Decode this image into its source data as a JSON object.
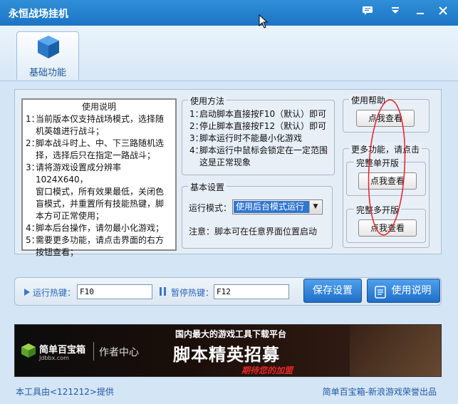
{
  "window": {
    "title": "永恒战场挂机"
  },
  "titlebar": {
    "icons": [
      "message-icon",
      "dropdown-icon",
      "minimize-icon",
      "close-icon"
    ]
  },
  "toolbar": {
    "tab_basic": "基础功能"
  },
  "instructions": {
    "title": "使用说明",
    "items": [
      {
        "num": "1：",
        "lines": [
          "当前版本仅支持战场模式，选择随",
          "机英雄进行战斗；"
        ]
      },
      {
        "num": "2：",
        "lines": [
          "脚本战斗时上、中、下三路随机选",
          "择，选择后只在指定一路战斗；"
        ]
      },
      {
        "num": "3：",
        "lines": [
          "请将游戏设置成分辨率1024X640，",
          "窗口模式，所有效果最低，关闭色",
          "盲模式，并重置所有技能热键，脚",
          "本方可正常使用；"
        ]
      },
      {
        "num": "4：",
        "lines": [
          "脚本后台操作，请勿最小化游戏；"
        ]
      },
      {
        "num": "5：",
        "lines": [
          "需要更多功能，请点击界面的右方",
          "按钮查看；"
        ]
      }
    ]
  },
  "usage": {
    "title": "使用方法",
    "items": [
      {
        "num": "1：",
        "lines": [
          "启动脚本直接按F10（默认）即可"
        ]
      },
      {
        "num": "2：",
        "lines": [
          "停止脚本直接按F12（默认）即可"
        ]
      },
      {
        "num": "3：",
        "lines": [
          "脚本运行时不能最小化游戏"
        ]
      },
      {
        "num": "4：",
        "lines": [
          "脚本运行中鼠标会锁定在一定范围",
          "这是正常现象"
        ]
      }
    ]
  },
  "basic_settings": {
    "title": "基本设置",
    "mode_label": "运行模式：",
    "mode_value": "使用后台模式运行",
    "note": "注意：脚本可在任意界面位置启动"
  },
  "help": {
    "title": "使用帮助",
    "button": "点我查看"
  },
  "more": {
    "title": "更多功能，请点击",
    "single": {
      "title": "完整单开版",
      "button": "点我查看"
    },
    "multi": {
      "title": "完整多开版",
      "button": "点我查看"
    }
  },
  "hotkeys": {
    "run_label": "运行热键：",
    "run_value": "F10",
    "pause_label": "暂停热键：",
    "pause_value": "F12",
    "save_button": "保存设置",
    "manual_button": "使用说明"
  },
  "banner": {
    "brand": "简单百宝箱",
    "brand_url": "Jdbbx.com",
    "author_center": "作者中心",
    "line1": "国内最大的游戏工具下载平台",
    "line2": "脚本精英招募",
    "line3": "期待您的加盟"
  },
  "footer": {
    "left": "本工具由<121212>提供",
    "right": "简单百宝箱-新浪游戏荣誉出品"
  },
  "colors": {
    "accent": "#1c74c4",
    "panel": "#e4edf6",
    "annotation": "#e8202a"
  }
}
